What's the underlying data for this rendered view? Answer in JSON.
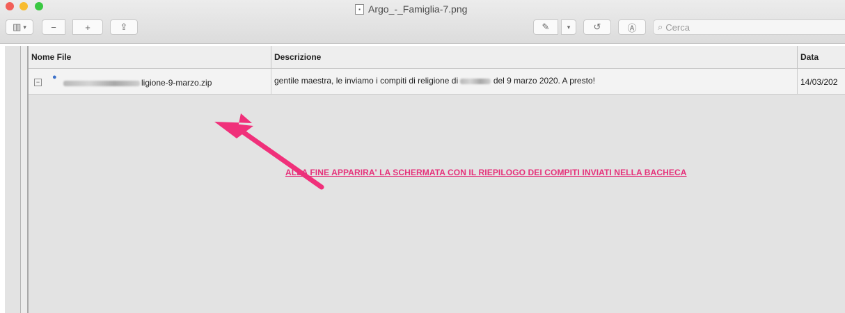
{
  "window": {
    "title": "Argo_-_Famiglia-7.png"
  },
  "toolbar": {
    "sidebar_icon": "sidebar-icon",
    "zoom_out_icon": "zoom-out-icon",
    "zoom_in_icon": "zoom-in-icon",
    "share_icon": "share-icon",
    "markup_icon": "pen-markup-icon",
    "rotate_icon": "rotate-icon",
    "annotate_icon": "annotate-icon",
    "search_placeholder": "Cerca"
  },
  "table": {
    "columns": [
      "Nome File",
      "Descrizione",
      "Data"
    ],
    "rows": [
      {
        "file_name_visible": "ligione-9-marzo.zip",
        "description_before": "gentile maestra, le inviamo i compiti di religione di",
        "description_after": "del 9 marzo 2020. A presto!",
        "date": "14/03/202"
      }
    ]
  },
  "annotation": {
    "text": "ALLA FINE APPARIRA' LA SCHERMATA CON IL RIEPILOGO DEI COMPITI INVIATI NELLA BACHECA",
    "color": "#e5317a"
  },
  "colors": {
    "close": "#f25f58",
    "minimize": "#f8bc2f",
    "zoom": "#3ac842",
    "arrow": "#f0307a"
  }
}
